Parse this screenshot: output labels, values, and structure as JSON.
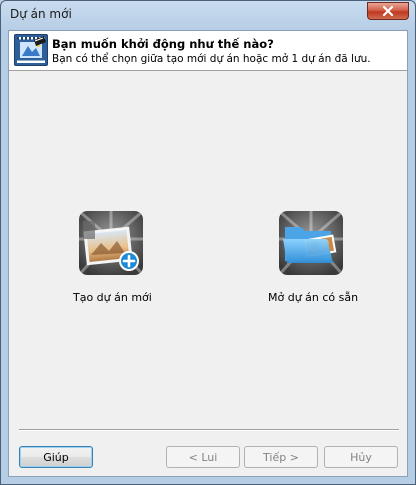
{
  "window": {
    "title": "Dự án mới"
  },
  "header": {
    "title": "Bạn muốn khởi động như thế nào?",
    "subtitle": "Bạn có thể chọn giữa tạo mới dự án hoặc mở 1 dự án đã lưu."
  },
  "options": {
    "new_project": {
      "label": "Tạo dự án mới",
      "icon": "new-project-icon"
    },
    "open_project": {
      "label": "Mở dự án có sẵn",
      "icon": "open-project-icon"
    }
  },
  "buttons": {
    "help": "Giúp",
    "back": "< Lui",
    "next": "Tiếp >",
    "cancel": "Hủy"
  },
  "colors": {
    "accent": "#3c7fb1",
    "close": "#c0391f",
    "folder": "#5ab0e6"
  }
}
